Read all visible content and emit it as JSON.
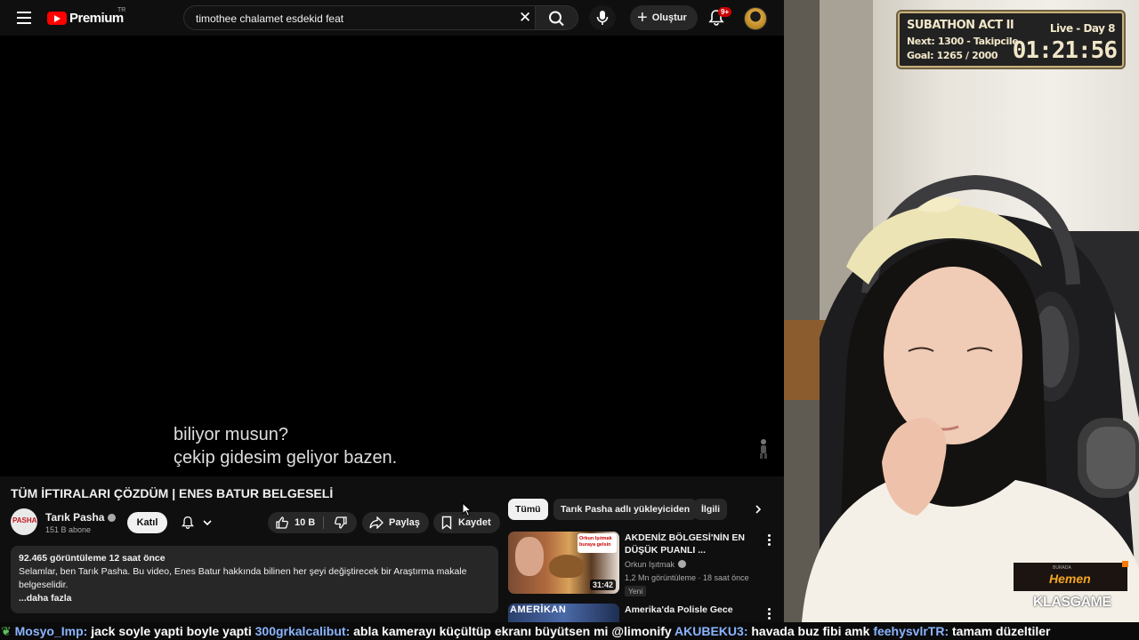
{
  "header": {
    "logo_text": "Premium",
    "country_code": "TR",
    "search_value": "timothee chalamet esdekid feat",
    "create_label": "Oluştur",
    "notification_badge": "9+"
  },
  "player": {
    "caption_line1": "biliyor musun?",
    "caption_line2": "çekip gidesim geliyor bazen."
  },
  "video": {
    "title": "TÜM İFTIRALARI ÇÖZDÜM | ENES BATUR BELGESELİ",
    "channel_name": "Tarık Pasha",
    "channel_avatar_text": "PASHA",
    "subscribers": "151 B abone",
    "join_label": "Katıl",
    "like_count": "10 B",
    "share_label": "Paylaş",
    "save_label": "Kaydet",
    "description": {
      "meta": "92.465 görüntüleme  12 saat önce",
      "text": "Selamlar, ben Tarık Pasha. Bu video, Enes Batur hakkında bilinen her şeyi değiştirecek bir Araştırma makale belgeselidir.",
      "more": "...daha fazla"
    }
  },
  "filter_chips": [
    {
      "label": "Tümü",
      "active": true
    },
    {
      "label": "Tarık Pasha adlı yükleyiciden",
      "active": false
    },
    {
      "label": "İlgili",
      "active": false
    }
  ],
  "recommendations": [
    {
      "title": "AKDENİZ BÖLGESİ'NİN EN DÜŞÜK PUANLI ...",
      "channel": "Orkun Işıtmak",
      "stats": "1,2 Mn görüntüleme · 18 saat önce",
      "badge": "Yeni",
      "duration": "31:42",
      "thumb_overlay": "Orkun Işıtmak buraya gelsin"
    },
    {
      "title": "Amerika'da Polisle Gece",
      "thumb_overlay": "AMERİKAN"
    }
  ],
  "overlay": {
    "subathon_title": "SUBATHON ACT II",
    "live_day": "Live - Day 8",
    "next_line": "Next: 1300 - Takipcilerl",
    "goal_line": "Goal: 1265 / 2000",
    "timer": "01:21:56",
    "sponsor_small": "BURADA",
    "sponsor_cta": "Hemen",
    "sponsor_brand": "KLASGAME"
  },
  "chat_ticker": [
    {
      "user": "Mosyo_Imp:",
      "message": " jack soyle yapti boyle yapti "
    },
    {
      "user": "300grkalcalibut:",
      "message": " abla kamerayı küçültüp ekranı büyütsen mi @limonify "
    },
    {
      "user": "AKUBEKU3:",
      "message": " havada buz fibi amk "
    },
    {
      "user": "feehysvlrTR:",
      "message": " tamam düzeltiler"
    }
  ],
  "colors": {
    "youtube_red": "#ff0000",
    "background": "#0f0f0f",
    "chip_bg": "#272727",
    "overlay_gold": "#c8b27a",
    "ticker_user": "#8ab4ff"
  }
}
